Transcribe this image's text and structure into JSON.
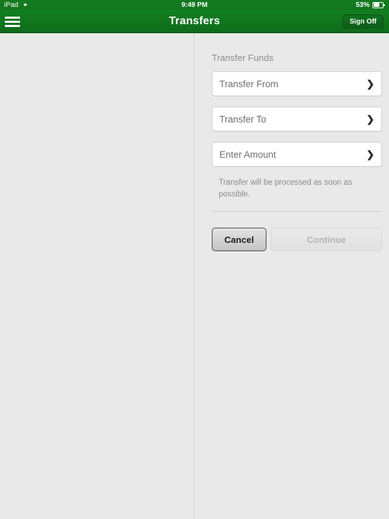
{
  "status_bar": {
    "device": "iPad",
    "wifi_icon": "wifi-icon",
    "time": "9:49 PM",
    "battery_percent": "53%",
    "battery_icon": "battery-icon"
  },
  "nav_bar": {
    "menu_icon": "hamburger-menu-icon",
    "title": "Transfers",
    "sign_off_label": "Sign Off"
  },
  "form": {
    "section_title": "Transfer Funds",
    "fields": [
      {
        "label": "Transfer From",
        "chevron_icon": "chevron-right-icon"
      },
      {
        "label": "Transfer To",
        "chevron_icon": "chevron-right-icon"
      },
      {
        "label": "Enter Amount",
        "chevron_icon": "chevron-right-icon"
      }
    ],
    "helper_text": "Transfer will be processed as soon as possible.",
    "cancel_label": "Cancel",
    "continue_label": "Continue"
  },
  "colors": {
    "nav_green": "#138021",
    "status_green": "#157b21",
    "background": "#e9e9e9",
    "field_border": "#cfcfcf",
    "muted_text": "#8a8a8a"
  },
  "glyphs": {
    "chevron_right": "❯"
  }
}
